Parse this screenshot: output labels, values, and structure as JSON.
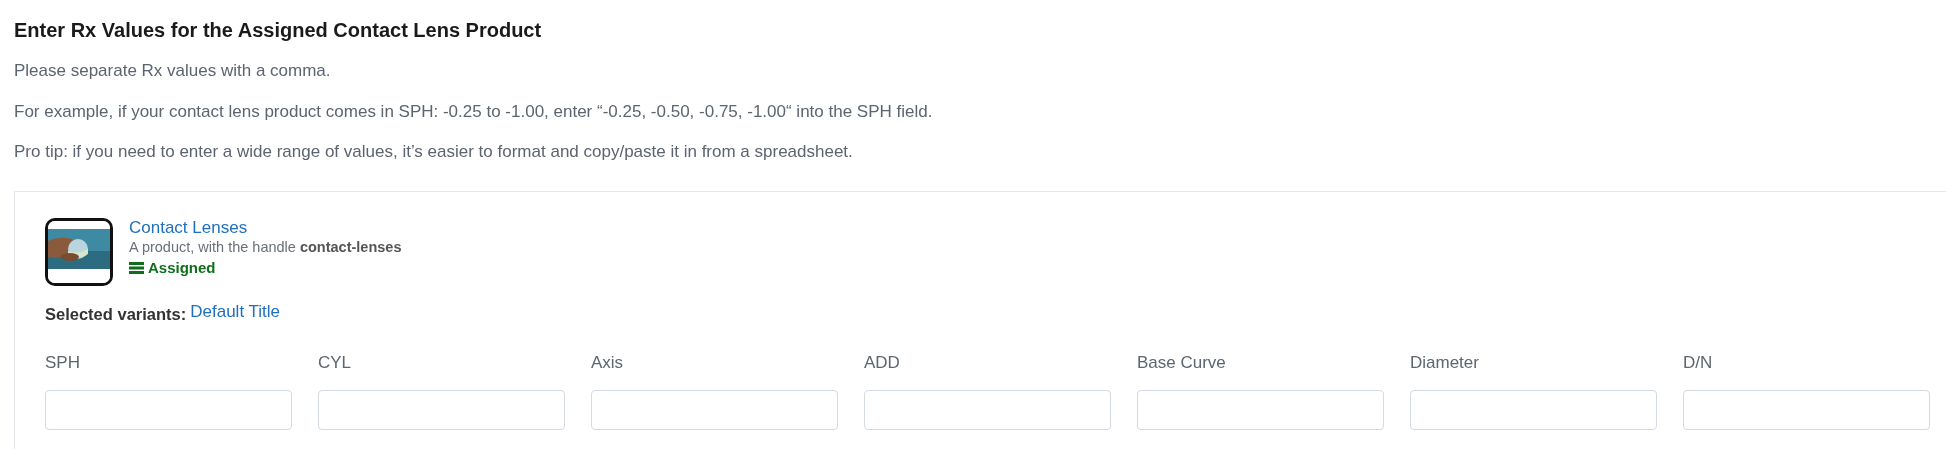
{
  "heading": "Enter Rx Values for the Assigned Contact Lens Product",
  "paragraphs": [
    "Please separate Rx values with a comma.",
    "For example, if your contact lens product comes in SPH: -0.25 to -1.00, enter “-0.25, -0.50, -0.75, -1.00“ into the SPH field.",
    "Pro tip: if you need to enter a wide range of values, it’s easier to format and copy/paste it in from a spreadsheet."
  ],
  "product": {
    "title": "Contact Lenses",
    "description": "A product, with the handle **contact-lenses**",
    "status": "Assigned"
  },
  "selected_variants": {
    "label": "Selected variants:",
    "value": "Default Title"
  },
  "fields": [
    {
      "label": "SPH"
    },
    {
      "label": "CYL"
    },
    {
      "label": "Axis"
    },
    {
      "label": "ADD"
    },
    {
      "label": "Base Curve"
    },
    {
      "label": "Diameter"
    },
    {
      "label": "D/N"
    }
  ]
}
